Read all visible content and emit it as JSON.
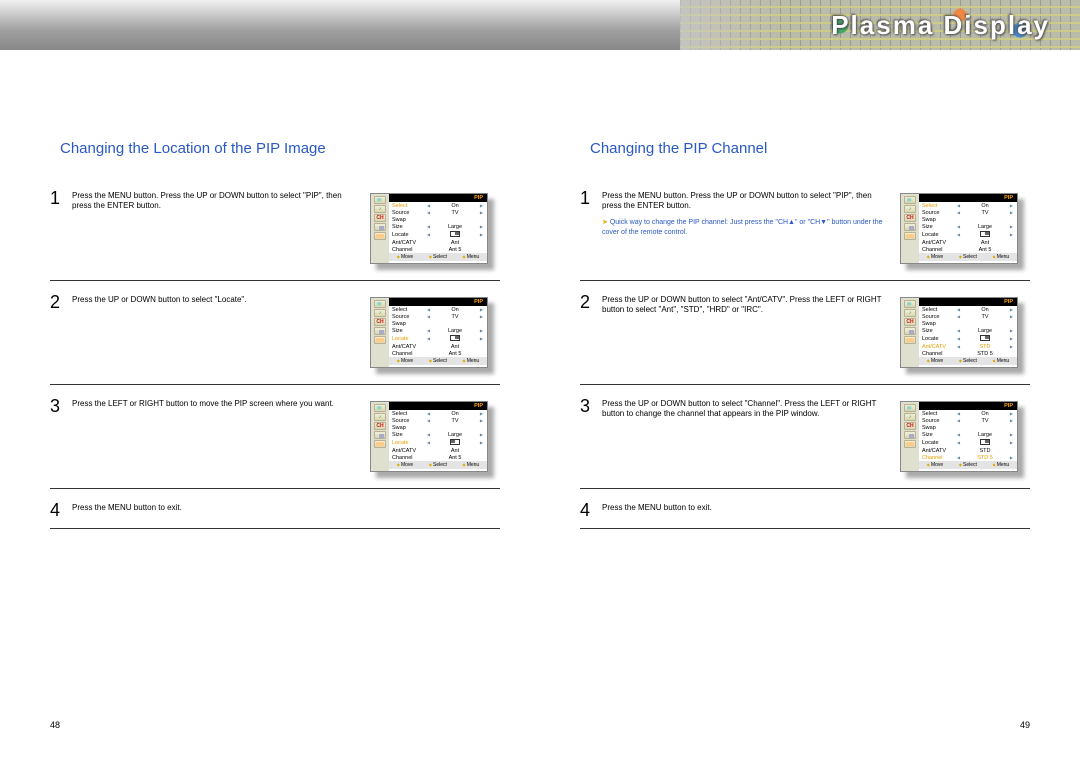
{
  "header": {
    "title": "Plasma Display"
  },
  "left": {
    "title": "Changing the Location of the PIP Image",
    "steps": [
      {
        "num": "1",
        "text": "Press the MENU button. Press the UP or DOWN button to select \"PIP\", then press the ENTER button."
      },
      {
        "num": "2",
        "text": "Press the UP or DOWN button to select \"Locate\"."
      },
      {
        "num": "3",
        "text": "Press the LEFT or RIGHT button to move the PIP screen where you want."
      },
      {
        "num": "4",
        "text": "Press the MENU button to exit."
      }
    ],
    "pagenum": "48"
  },
  "right": {
    "title": "Changing the PIP Channel",
    "steps": [
      {
        "num": "1",
        "text": "Press the MENU button. Press the UP or DOWN button to select \"PIP\", then press the ENTER button.",
        "note": "Quick way to change the PIP channel: Just press the \"CH▲\" or \"CH▼\" button under the cover of the remote control."
      },
      {
        "num": "2",
        "text": "Press the UP or DOWN button to select \"Ant/CATV\". Press the LEFT or RIGHT button to select \"Ant\", \"STD\", \"HRD\" or \"IRC\"."
      },
      {
        "num": "3",
        "text": "Press the UP or DOWN button to select \"Channel\". Press the LEFT or RIGHT button to change the channel that appears in the PIP window."
      },
      {
        "num": "4",
        "text": "Press the MENU button to exit."
      }
    ],
    "pagenum": "49"
  },
  "osd": {
    "title": "PIP",
    "labels": {
      "select": "Select",
      "source": "Source",
      "swap": "Swap",
      "size": "Size",
      "locate": "Locate",
      "antcatv": "Ant/CATV",
      "channel": "Channel"
    },
    "vals": {
      "on": "On",
      "tv": "TV",
      "large": "Large",
      "ant": "Ant",
      "ant5": "Ant   5",
      "std": "STD",
      "std5": "STD   5"
    },
    "foot": {
      "move": "Move",
      "select": "Select",
      "menu": "Menu"
    }
  }
}
